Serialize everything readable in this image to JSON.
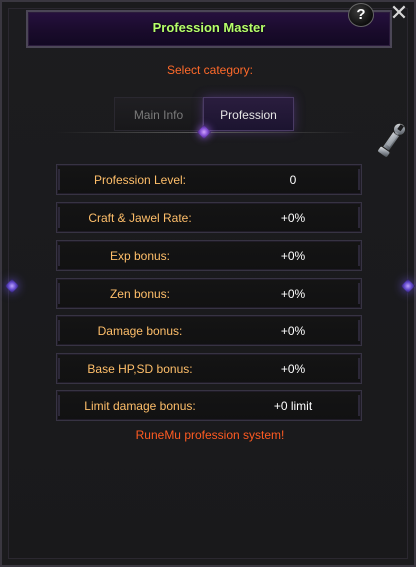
{
  "window": {
    "title": "Profession Master",
    "subtitle": "Select category:",
    "footer": "RuneMu profession system!"
  },
  "controls": {
    "help": "?",
    "close": "✕"
  },
  "tabs": [
    {
      "label": "Main Info",
      "selected": false
    },
    {
      "label": "Profession",
      "selected": true
    }
  ],
  "profession": {
    "rows": [
      {
        "label": "Profession Level:",
        "value": "0"
      },
      {
        "label": "Craft & Jawel Rate:",
        "value": "+0%"
      },
      {
        "label": "Exp bonus:",
        "value": "+0%"
      },
      {
        "label": "Zen bonus:",
        "value": "+0%"
      },
      {
        "label": "Damage bonus:",
        "value": "+0%"
      },
      {
        "label": "Base HP,SD bonus:",
        "value": "+0%"
      },
      {
        "label": "Limit damage bonus:",
        "value": "+0 limit"
      }
    ]
  },
  "icons": {
    "wrench": "wrench-icon",
    "help": "help-icon",
    "close": "close-icon",
    "diamond": "diamond-icon"
  },
  "colors": {
    "title_green": "#b6ff6a",
    "accent_orange": "#ff6a2a",
    "label_orange": "#ffbf6a",
    "purple_glow": "#844cd6"
  }
}
